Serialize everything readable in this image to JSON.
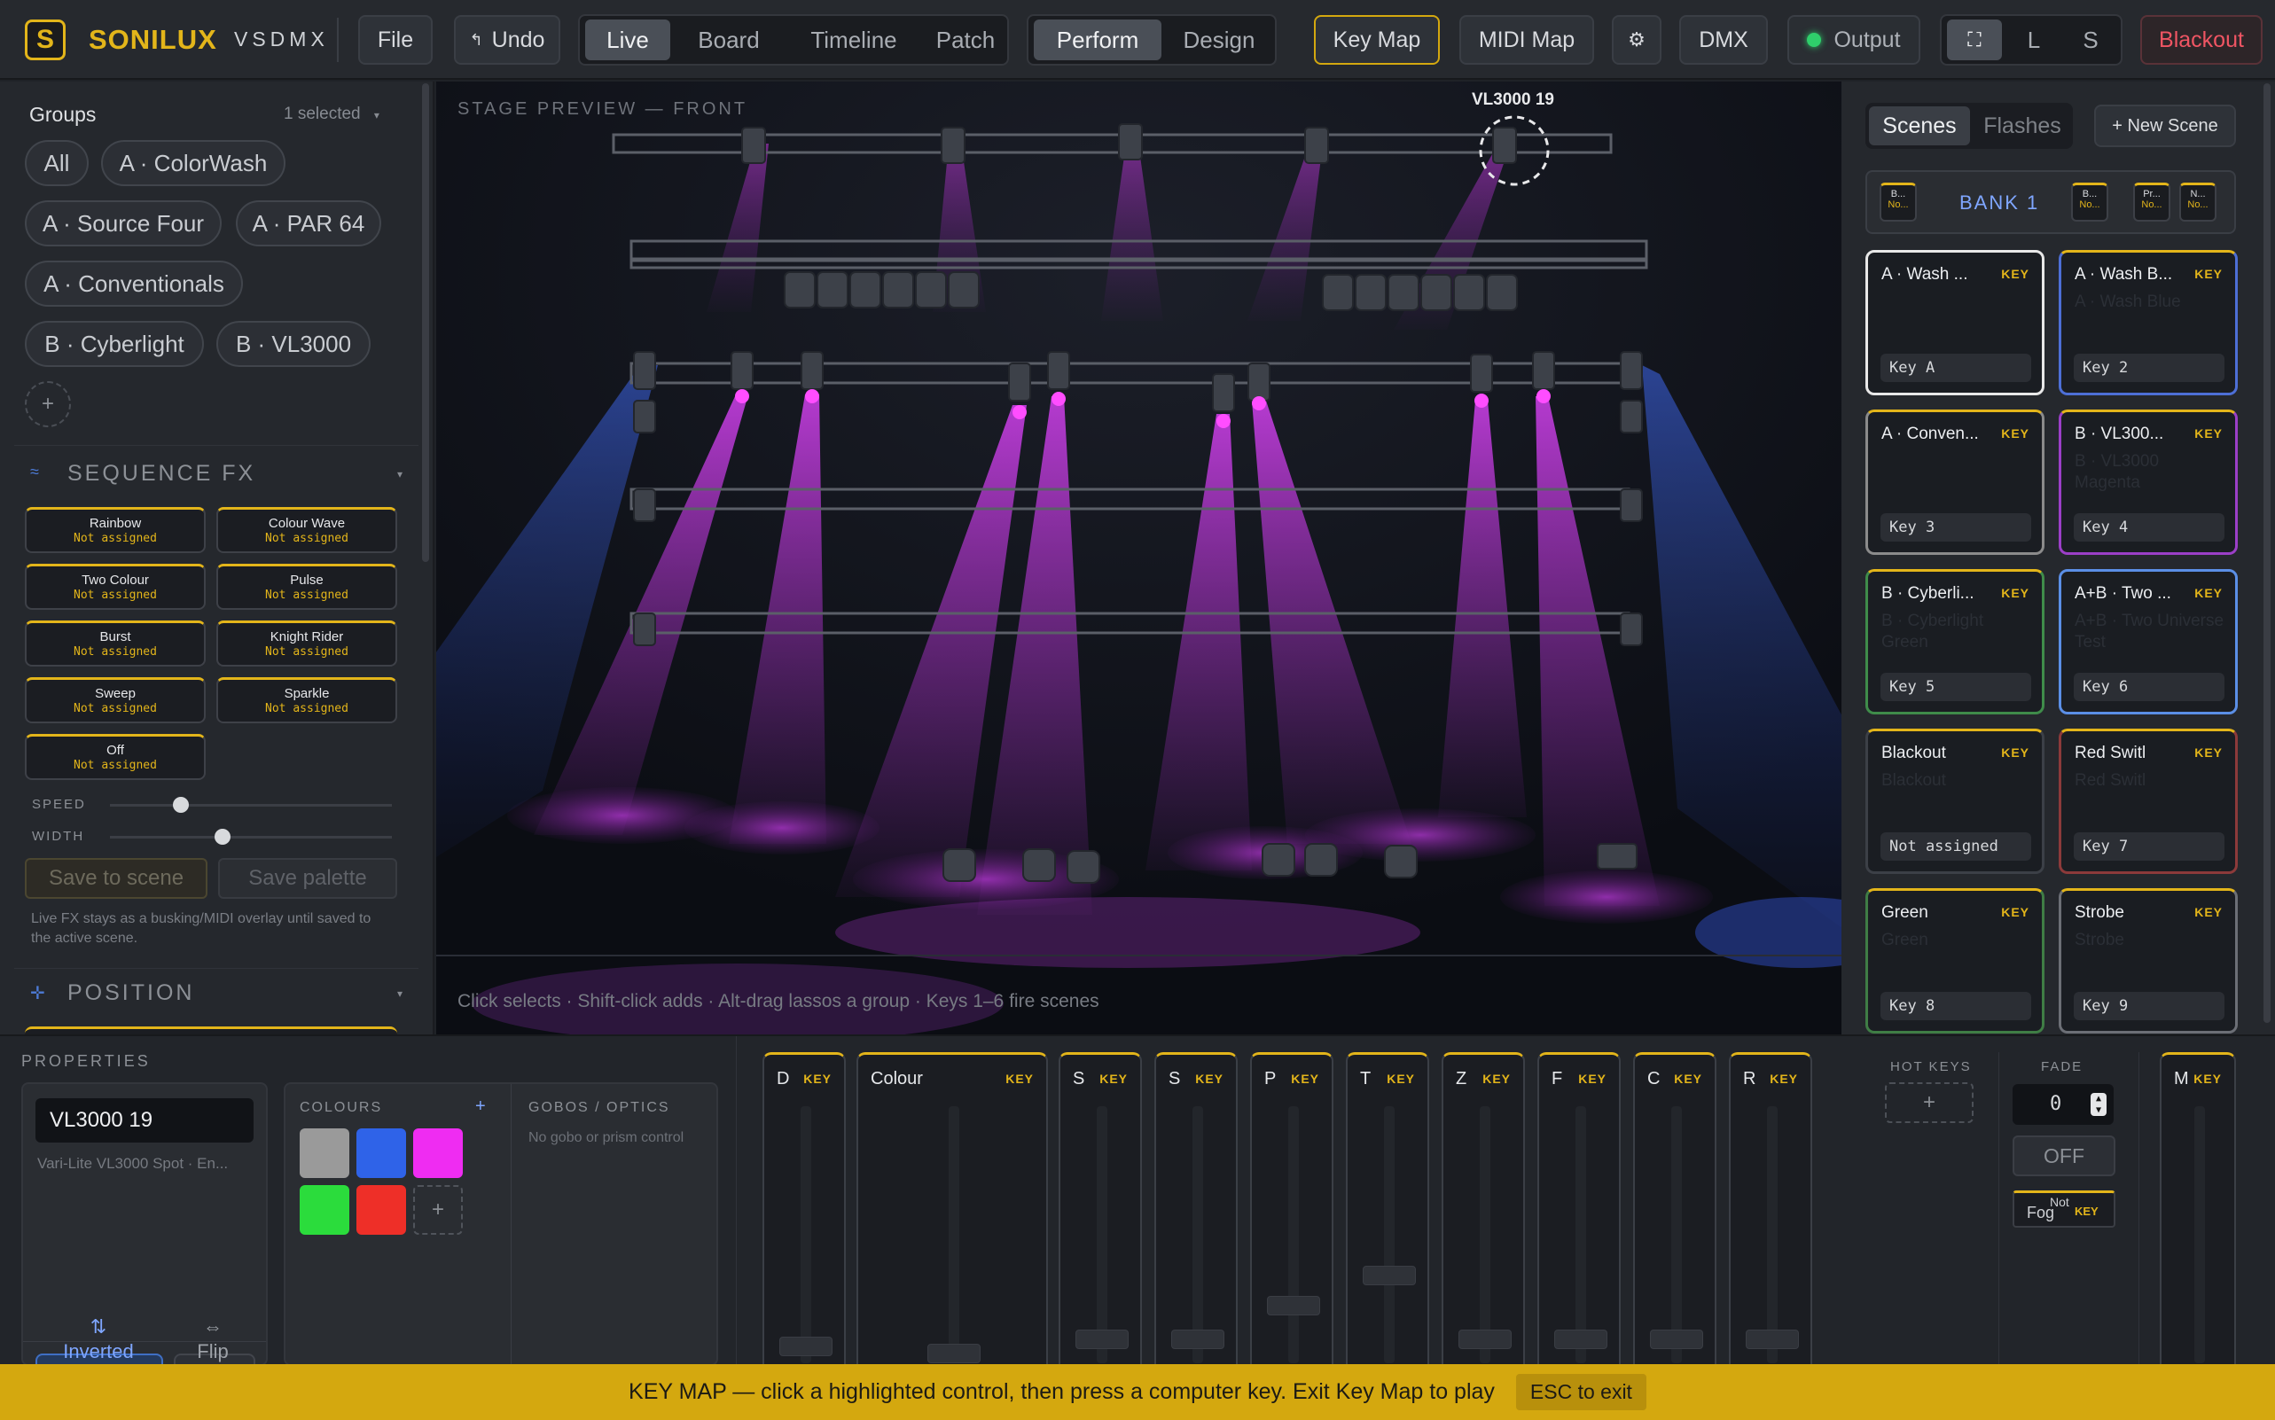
{
  "app": {
    "brand": "SONILUX",
    "product": "VSDMX",
    "logo_letter": "S"
  },
  "topbar": {
    "file": "File",
    "undo": "Undo",
    "view_tabs": [
      "Live",
      "Board",
      "Timeline",
      "Patch"
    ],
    "active_view": "Live",
    "mode_tabs": [
      "Perform",
      "Design"
    ],
    "active_mode": "Perform",
    "key_map": "Key Map",
    "midi_map": "MIDI Map",
    "settings_icon": "gear-icon",
    "dmx": "DMX",
    "output": "Output",
    "output_status_color": "#2fcf6b",
    "size_tabs": [
      "⛶",
      "L",
      "S"
    ],
    "blackout": "Blackout"
  },
  "groups": {
    "title": "Groups",
    "selected": "1 selected",
    "items": [
      "All",
      "A · ColorWash",
      "A · Source Four",
      "A · PAR 64",
      "A · Conventionals",
      "B · Cyberlight",
      "B · VL3000"
    ],
    "add": "+"
  },
  "sequence_fx": {
    "title": "SEQUENCE FX",
    "effects": [
      {
        "name": "Rainbow",
        "status": "Not assigned"
      },
      {
        "name": "Colour Wave",
        "status": "Not assigned"
      },
      {
        "name": "Two Colour",
        "status": "Not assigned"
      },
      {
        "name": "Pulse",
        "status": "Not assigned"
      },
      {
        "name": "Burst",
        "status": "Not assigned"
      },
      {
        "name": "Knight Rider",
        "status": "Not assigned"
      },
      {
        "name": "Sweep",
        "status": "Not assigned"
      },
      {
        "name": "Sparkle",
        "status": "Not assigned"
      },
      {
        "name": "Off",
        "status": "Not assigned"
      }
    ],
    "speed_label": "SPEED",
    "speed_value": 0.25,
    "width_label": "WIDTH",
    "width_value": 0.4,
    "save_scene": "Save to scene",
    "save_palette": "Save palette",
    "note": "Live FX stays as a busking/MIDI overlay until saved to the active scene."
  },
  "position": {
    "title": "POSITION"
  },
  "stage": {
    "title": "STAGE PREVIEW — FRONT",
    "selected_fixture": "VL3000 19",
    "hint": "Click selects · Shift-click adds · Alt-drag lassos a group · Keys 1–6 fire scenes",
    "beam_color": "#c23adf",
    "side_beam_color": "#2b52c8"
  },
  "scenes_panel": {
    "tabs": [
      "Scenes",
      "Flashes"
    ],
    "active_tab": "Scenes",
    "new_scene": "+ New Scene",
    "bank": "BANK 1",
    "bank_mini": [
      {
        "t": "B...",
        "s": "No..."
      },
      {
        "t": "B...",
        "s": "No..."
      },
      {
        "t": "Pr...",
        "s": "No..."
      },
      {
        "t": "N...",
        "s": "No..."
      }
    ],
    "key_tag": "KEY",
    "scenes": [
      {
        "title": "A · Wash ...",
        "ghost": "",
        "key": "Key A",
        "border": "#e8e8e8"
      },
      {
        "title": "A · Wash B...",
        "ghost": "A · Wash Blue",
        "key": "Key 2",
        "border": "#4d6fd6"
      },
      {
        "title": "A · Conven...",
        "ghost": "",
        "key": "Key 3",
        "border": "#8b8b8b"
      },
      {
        "title": "B · VL300...",
        "ghost": "B · VL3000 Magenta",
        "key": "Key 4",
        "border": "#9b3fc7"
      },
      {
        "title": "B · Cyberli...",
        "ghost": "B · Cyberlight Green",
        "key": "Key 5",
        "border": "#3f8c4a"
      },
      {
        "title": "A+B · Two ...",
        "ghost": "A+B · Two Universe Test",
        "key": "Key 6",
        "border": "#5b8fe6"
      },
      {
        "title": "Blackout",
        "ghost": "Blackout",
        "key": "Not assigned",
        "border": "#3c4047"
      },
      {
        "title": "Red Switl",
        "ghost": "Red Switl",
        "key": "Key 7",
        "border": "#8c3a3a"
      },
      {
        "title": "Green",
        "ghost": "Green",
        "key": "Key 8",
        "border": "#3f7d45"
      },
      {
        "title": "Strobe",
        "ghost": "Strobe",
        "key": "Key 9",
        "border": "#6c6f76"
      }
    ]
  },
  "properties": {
    "title": "PROPERTIES",
    "fixture_name": "VL3000 19",
    "fixture_type": "Vari-Lite VL3000 Spot · En...",
    "inverted": "Inverted",
    "flip": "Flip",
    "colours_title": "COLOURS",
    "colours": [
      "#9a9a9a",
      "#2f63e8",
      "#ef2cf2",
      "#2bdc3c",
      "#ee2f28"
    ],
    "gobos_title": "GOBOS / OPTICS",
    "gobos_note": "No gobo or prism control"
  },
  "faders": {
    "key_tag": "KEY",
    "channels": [
      {
        "label": "D",
        "level": 0.03
      },
      {
        "label": "Colour",
        "level": 0
      },
      {
        "label": "S",
        "level": 0.06
      },
      {
        "label": "S",
        "level": 0.06
      },
      {
        "label": "P",
        "level": 0.2
      },
      {
        "label": "T",
        "level": 0.33
      },
      {
        "label": "Z",
        "level": 0.06
      },
      {
        "label": "F",
        "level": 0.06
      },
      {
        "label": "C",
        "level": 0.06
      },
      {
        "label": "R",
        "level": 0.06
      }
    ],
    "master_label": "M"
  },
  "hot_keys": {
    "title": "HOT KEYS",
    "add": "+"
  },
  "fade": {
    "title": "FADE",
    "value": "0",
    "off": "OFF",
    "fog": "Fog",
    "fog_sub": "Not"
  },
  "keymap_banner": {
    "text": "KEY MAP — click a highlighted control, then press a computer key. Exit Key Map to play",
    "esc": "ESC to exit"
  }
}
